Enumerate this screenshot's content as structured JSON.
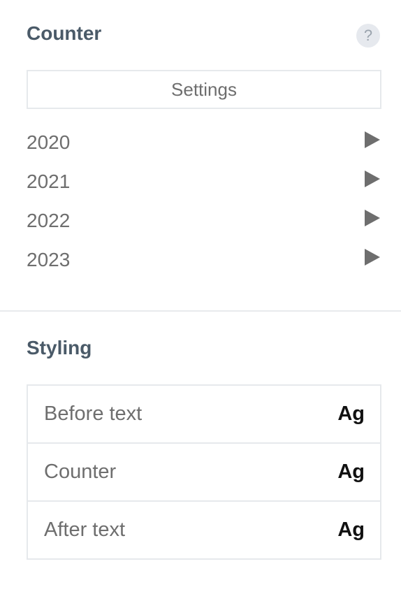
{
  "counter_section": {
    "title": "Counter",
    "help_glyph": "?",
    "settings_label": "Settings",
    "years": [
      {
        "label": "2020",
        "icon": "play-icon"
      },
      {
        "label": "2021",
        "icon": "play-icon"
      },
      {
        "label": "2022",
        "icon": "play-icon"
      },
      {
        "label": "2023",
        "icon": "play-icon"
      }
    ]
  },
  "styling_section": {
    "title": "Styling",
    "rows": [
      {
        "label": "Before text",
        "typography_glyph": "Ag"
      },
      {
        "label": "Counter",
        "typography_glyph": "Ag"
      },
      {
        "label": "After text",
        "typography_glyph": "Ag"
      }
    ]
  },
  "colors": {
    "heading": "#4a5a68",
    "text": "#6e6e6e",
    "border": "#e6e9ec",
    "icon_bg": "#e6e9ee"
  }
}
